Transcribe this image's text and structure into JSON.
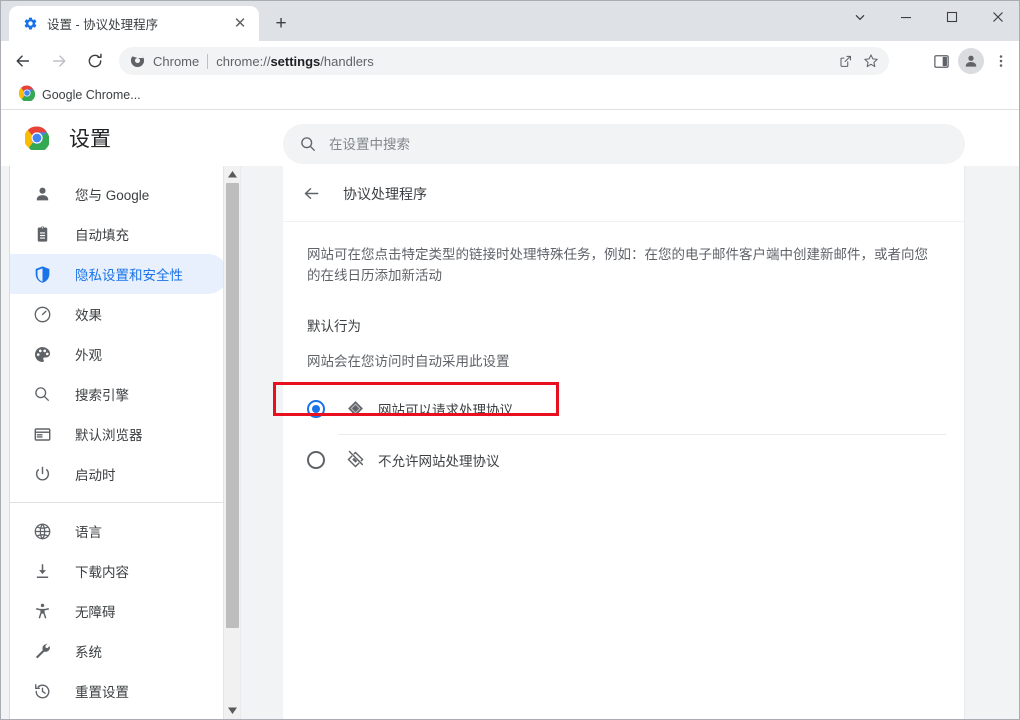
{
  "window": {
    "controls": [
      {
        "name": "tab-search-chevron",
        "glyph": "chevron-down-icon"
      },
      {
        "name": "minimize",
        "glyph": "minimize-icon"
      },
      {
        "name": "maximize",
        "glyph": "maximize-icon"
      },
      {
        "name": "close",
        "glyph": "close-icon"
      }
    ]
  },
  "tabstrip": {
    "tab": {
      "title": "设置 - 协议处理程序",
      "favicon": "gear-icon",
      "close_label": "✕"
    },
    "new_tab_label": "+"
  },
  "toolbar": {
    "back_label": "←",
    "forward_label": "→",
    "reload_label": "⟳",
    "omnibox": {
      "security_icon": "chrome-icon",
      "chip_text": "Chrome",
      "url_prefix": "chrome://",
      "url_bold": "settings",
      "url_suffix": "/handlers"
    },
    "share_icon": "share-icon",
    "bookmark_icon": "star-icon",
    "sidepanel_icon": "side-panel-icon",
    "profile_icon": "avatar-icon",
    "menu_icon": "three-dot-menu-icon"
  },
  "bookmarks": {
    "items": [
      {
        "label": "Google Chrome...",
        "icon": "chrome-icon"
      }
    ]
  },
  "settings": {
    "brand_icon": "chrome-logo-icon",
    "title": "设置",
    "search": {
      "icon": "search-icon",
      "placeholder": "在设置中搜索",
      "value": ""
    }
  },
  "sidebar": {
    "group_primary": [
      {
        "label": "您与 Google",
        "icon": "person-icon",
        "active": false
      },
      {
        "label": "自动填充",
        "icon": "clipboard-icon",
        "active": false
      },
      {
        "label": "隐私设置和安全性",
        "icon": "shield-icon",
        "active": true
      },
      {
        "label": "效果",
        "icon": "speedometer-icon",
        "active": false
      },
      {
        "label": "外观",
        "icon": "palette-icon",
        "active": false
      },
      {
        "label": "搜索引擎",
        "icon": "search-icon",
        "active": false
      },
      {
        "label": "默认浏览器",
        "icon": "browser-window-icon",
        "active": false
      },
      {
        "label": "启动时",
        "icon": "power-icon",
        "active": false
      }
    ],
    "group_secondary": [
      {
        "label": "语言",
        "icon": "globe-icon",
        "active": false
      },
      {
        "label": "下载内容",
        "icon": "download-icon",
        "active": false
      },
      {
        "label": "无障碍",
        "icon": "accessibility-icon",
        "active": false
      },
      {
        "label": "系统",
        "icon": "wrench-icon",
        "active": false
      },
      {
        "label": "重置设置",
        "icon": "history-restore-icon",
        "active": false
      }
    ],
    "scrollbar": {
      "up_arrow": "▲",
      "down_arrow": "▼"
    }
  },
  "main": {
    "back_icon": "arrow-left-icon",
    "title": "协议处理程序",
    "description": "网站可在您点击特定类型的链接时处理特殊任务，例如：在您的电子邮件客户端中创建新邮件，或者向您的在线日历添加新活动",
    "default_behavior_label": "默认行为",
    "default_behavior_sublabel": "网站会在您访问时自动采用此设置",
    "options": [
      {
        "label": "网站可以请求处理协议",
        "icon": "protocol-handler-icon",
        "selected": true,
        "highlighted": true
      },
      {
        "label": "不允许网站处理协议",
        "icon": "protocol-handler-blocked-icon",
        "selected": false,
        "highlighted": false
      }
    ]
  },
  "colors": {
    "accent_blue": "#1a73e8",
    "active_pill": "#e8f0fe",
    "annotation_red": "#e8101e",
    "chrome_frame": "#dee1e6",
    "page_bg": "#f1f3f4",
    "text_primary": "#3c4043",
    "text_secondary": "#5f6368"
  }
}
